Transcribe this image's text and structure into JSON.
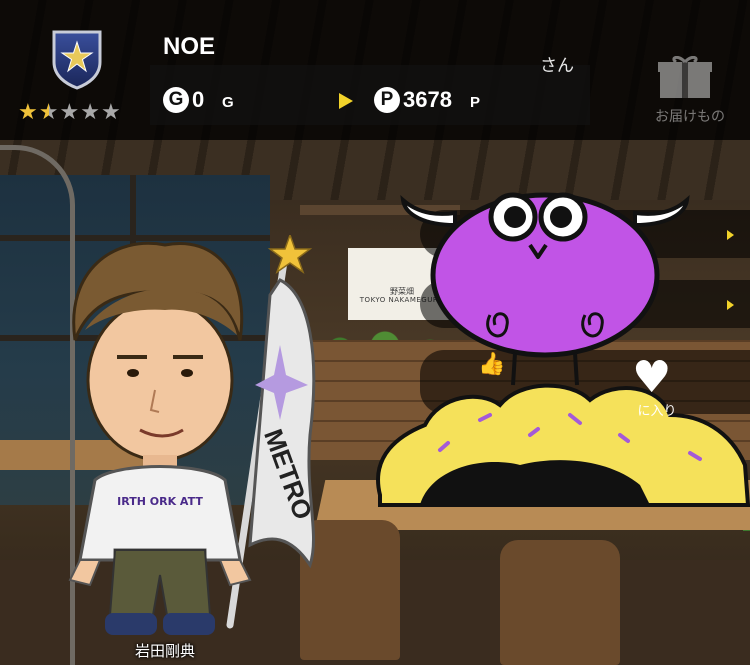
{
  "header": {
    "player_name": "NOE",
    "honorific": "さん",
    "rank_stars_filled": 1.5,
    "rank_stars_total": 5,
    "gold": {
      "icon_letter": "G",
      "value": "0",
      "unit": "G"
    },
    "points": {
      "icon_letter": "P",
      "value": "3678",
      "unit": "P"
    },
    "gift_label": "お届けもの"
  },
  "favorite": {
    "label": "に入り"
  },
  "member": {
    "name": "岩田剛典"
  },
  "flag_text": "METRO",
  "sign": {
    "jp": "野菜畑",
    "en": "TOKYO NAKAMEGURO"
  },
  "shirt_text": "IRTH ORK ATT",
  "colors": {
    "accent_yellow": "#f2d32a",
    "mascot_purple": "#c154e6",
    "cushion_yellow": "#f5e15a",
    "star_gold": "#f0c23a"
  },
  "icons": {
    "rank": "shield-star-icon",
    "gold": "coin-g-icon",
    "points": "coin-p-icon",
    "gift": "gift-box-icon",
    "favorite": "heart-icon",
    "like": "thumbs-up-icon"
  }
}
